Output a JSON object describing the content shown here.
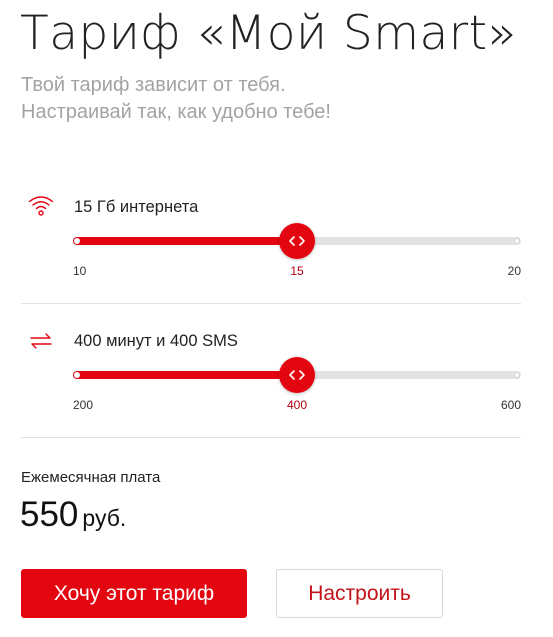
{
  "header": {
    "title": "Тариф «Мой Smart»",
    "subtitle_line1": "Твой тариф зависит от тебя.",
    "subtitle_line2": "Настраивай так, как удобно тебе!"
  },
  "sliders": [
    {
      "icon": "wifi-icon",
      "label": "15 Гб интернета",
      "min": 10,
      "max": 20,
      "value": 15,
      "ticks": [
        "10",
        "15",
        "20"
      ]
    },
    {
      "icon": "exchange-arrows-icon",
      "label": "400 минут и 400 SMS",
      "min": 200,
      "max": 600,
      "value": 400,
      "ticks": [
        "200",
        "400",
        "600"
      ]
    }
  ],
  "fee": {
    "label": "Ежемесячная плата",
    "amount": "550",
    "currency": "руб."
  },
  "actions": {
    "primary_label": "Хочу этот тариф",
    "secondary_label": "Настроить"
  },
  "colors": {
    "accent": "#e30611",
    "track": "#e3e3e3",
    "subtitle": "#a3a3a3"
  }
}
